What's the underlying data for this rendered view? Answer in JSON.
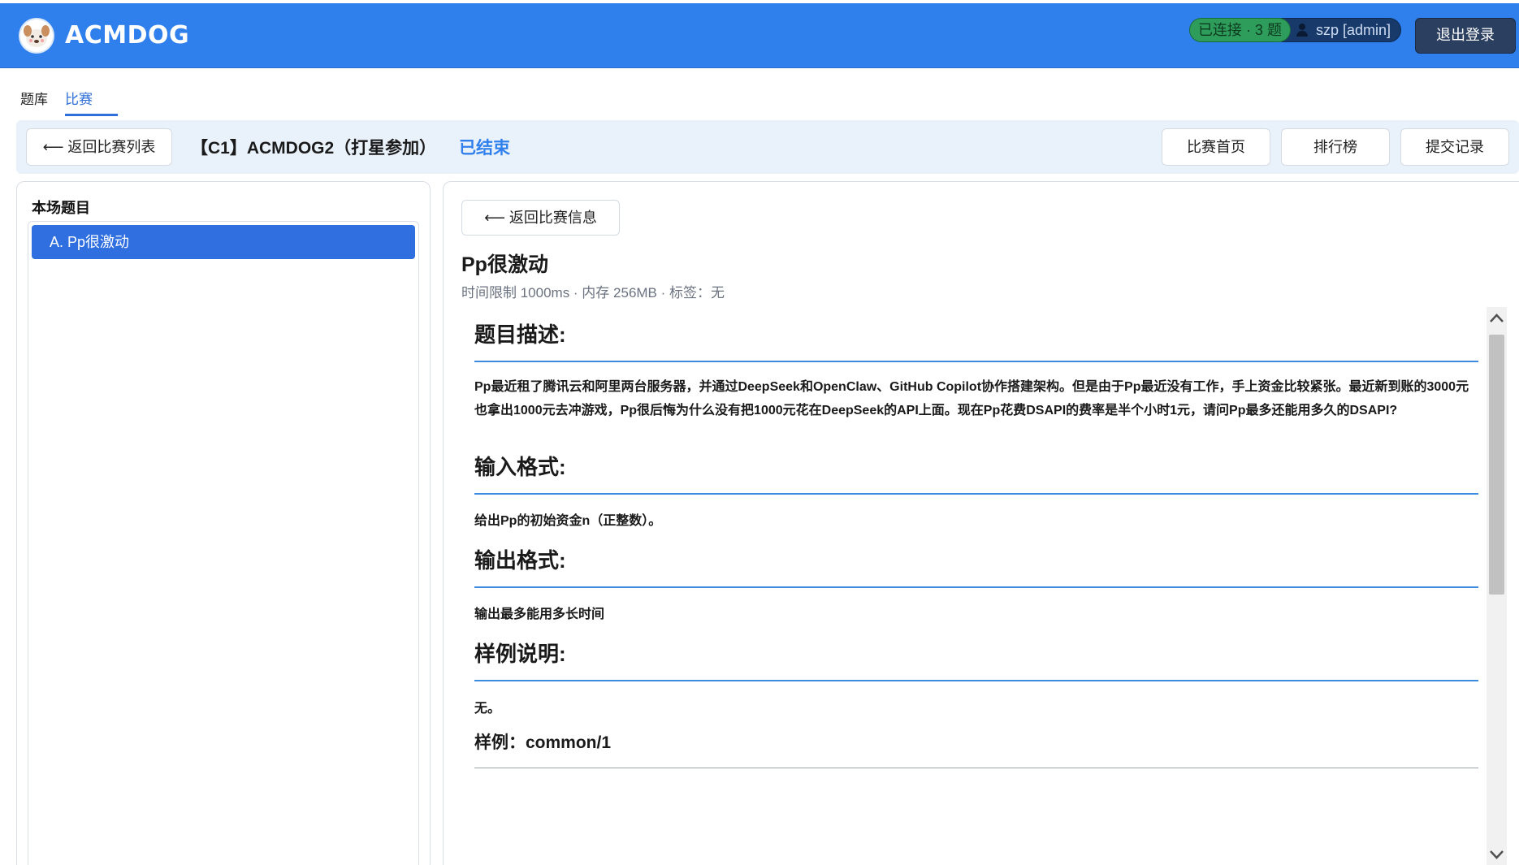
{
  "header": {
    "brand": "ACMDOG",
    "logo_icon": "dog-mascot-icon",
    "connection": "已连接 · 3 题",
    "user": "szp [admin]",
    "logout_label": "退出登录",
    "colors": {
      "primary": "#2f80ed",
      "connected": "#2e9c5a",
      "user_badge": "#173a6b",
      "logout": "#2b3f61"
    }
  },
  "nav": {
    "tabs": [
      {
        "label": "题库",
        "active": false
      },
      {
        "label": "比赛",
        "active": true
      }
    ]
  },
  "contest": {
    "back_label": "⟵ 返回比赛列表",
    "title": "【C1】ACMDOG2（打星参加）",
    "status": "已结束",
    "buttons": {
      "home": "比赛首页",
      "rank": "排行榜",
      "submissions": "提交记录"
    }
  },
  "sidebar": {
    "title": "本场题目",
    "problems": [
      {
        "label": "A. Pp很激动",
        "selected": true
      }
    ]
  },
  "problem": {
    "back_label": "⟵ 返回比赛信息",
    "title": "Pp很激动",
    "meta": "时间限制 1000ms · 内存 256MB · 标签：无",
    "sections": {
      "description_title": "题目描述:",
      "description": "Pp最近租了腾讯云和阿里两台服务器，并通过DeepSeek和OpenClaw、GitHub Copilot协作搭建架构。但是由于Pp最近没有工作，手上资金比较紧张。最近新到账的3000元也拿出1000元去冲游戏，Pp很后悔为什么没有把1000元花在DeepSeek的API上面。现在Pp花费DSAPI的费率是半个小时1元，请问Pp最多还能用多久的DSAPI?",
      "input_title": "输入格式:",
      "input": "给出Pp的初始资金n（正整数）。",
      "output_title": "输出格式:",
      "output": "输出最多能用多长时间",
      "sample_note_title": "样例说明:",
      "sample_note": "无。",
      "sample_title": "样例：common/1"
    }
  },
  "scrollbar": {
    "up_icon": "chevron-up-icon",
    "down_icon": "chevron-down-icon"
  }
}
